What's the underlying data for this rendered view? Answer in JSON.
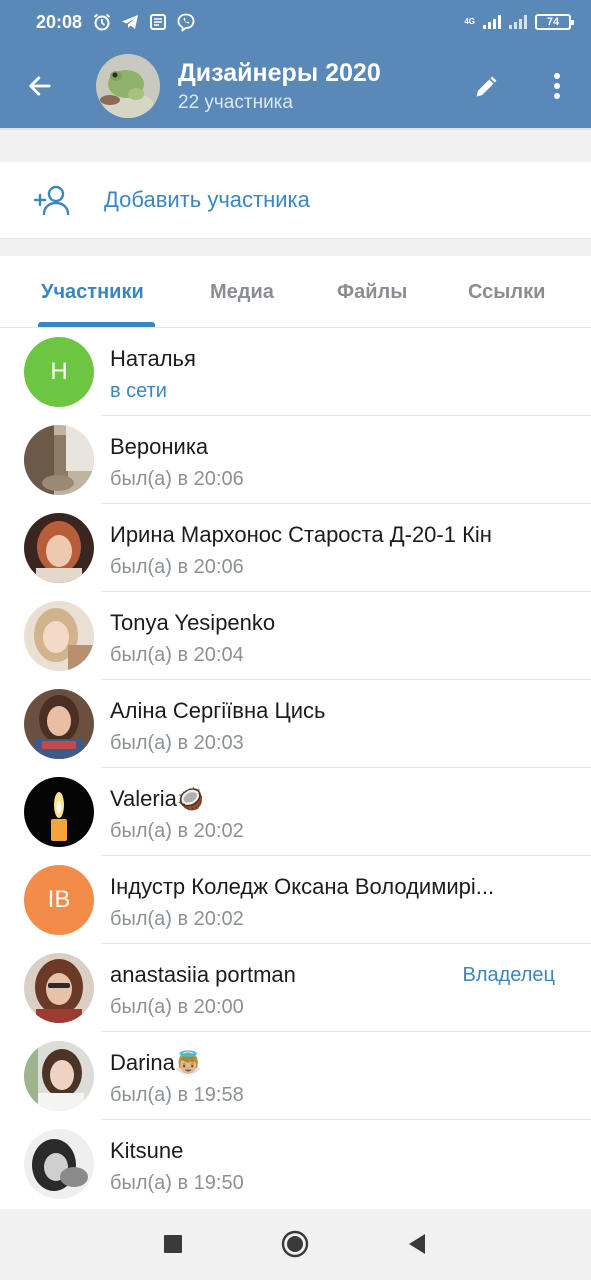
{
  "status_bar": {
    "time": "20:08",
    "network": "4G",
    "battery": "74",
    "icons": [
      "alarm-icon",
      "telegram-icon",
      "news-icon",
      "viber-icon"
    ]
  },
  "header": {
    "title": "Дизайнеры 2020",
    "subtitle": "22 участника",
    "avatar_icon": "frog-photo"
  },
  "add_member": {
    "label": "Добавить участника"
  },
  "tabs": [
    {
      "label": "Участники",
      "active": true
    },
    {
      "label": "Медиа",
      "active": false
    },
    {
      "label": "Файлы",
      "active": false
    },
    {
      "label": "Ссылки",
      "active": false
    }
  ],
  "members": [
    {
      "name": "Наталья",
      "status": "в сети",
      "initials": "Н",
      "color": "#6cc641",
      "online": true
    },
    {
      "name": "Вероника",
      "status": "был(а) в 20:06",
      "avatar": "photo"
    },
    {
      "name": "Ирина Мархонос Староста Д-20-1 Кін",
      "status": "был(а) в 20:06",
      "avatar": "photo"
    },
    {
      "name": "Tonya Yesipenko",
      "status": "был(а) в 20:04",
      "avatar": "photo"
    },
    {
      "name": "Аліна Сергіївна Цись",
      "status": "был(а) в 20:03",
      "avatar": "photo"
    },
    {
      "name": "Valeria🥥",
      "status": "был(а) в 20:02",
      "avatar": "candle-photo"
    },
    {
      "name": "Індустр Коледж Оксана Володимирі...",
      "status": "был(а) в 20:02",
      "initials": "IB",
      "color": "#f28c48"
    },
    {
      "name": "anastasiia portman",
      "status": "был(а) в 20:00",
      "role": "Владелец",
      "avatar": "photo"
    },
    {
      "name": "Darina👼🏼",
      "status": "был(а) в 19:58",
      "avatar": "photo"
    },
    {
      "name": "Kitsune",
      "status": "был(а) в 19:50",
      "avatar": "photo"
    }
  ],
  "colors": {
    "header": "#5a89b7",
    "accent": "#3a87c0",
    "online_avatar": "#6cc641",
    "ib_avatar": "#f28c48"
  }
}
